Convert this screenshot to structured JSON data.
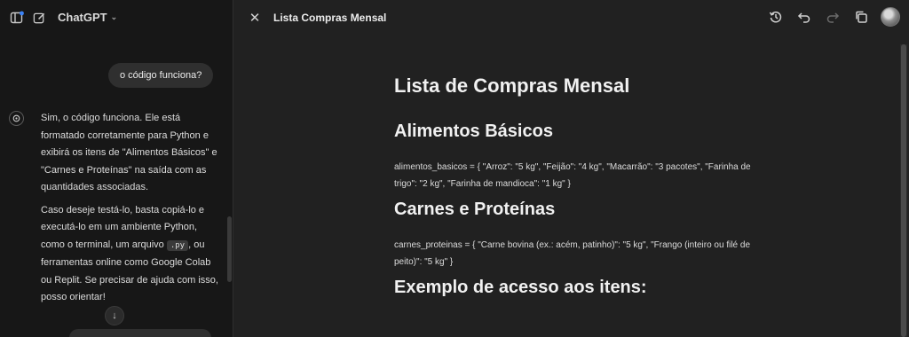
{
  "sidebar": {
    "model_label": "ChatGPT",
    "icons": [
      "sidebar-toggle-icon",
      "new-chat-icon",
      "chevron-down-icon"
    ]
  },
  "chat": {
    "user_message": "o código funciona?",
    "assistant_p1": "Sim, o código funciona. Ele está formatado corretamente para Python e exibirá os itens de \"Alimentos Básicos\" e \"Carnes e Proteínas\" na saída com as quantidades associadas.",
    "assistant_p2_a": "Caso deseje testá-lo, basta copiá-lo e executá-lo em um ambiente Python, como o terminal, um arquivo ",
    "assistant_p2_code": ".py",
    "assistant_p2_b": ", ou ferramentas online como Google Colab ou Replit. Se precisar de ajuda com isso, posso orientar!",
    "scroll_down_glyph": "↓"
  },
  "canvas": {
    "title": "Lista Compras Mensal",
    "close_glyph": "✕",
    "actions": [
      "history-icon",
      "undo-icon",
      "redo-icon",
      "copy-icon",
      "avatar"
    ],
    "doc": {
      "h1": "Lista de Compras Mensal",
      "h2_1": "Alimentos Básicos",
      "p_1": "alimentos_basicos = { \"Arroz\": \"5 kg\", \"Feijão\": \"4 kg\", \"Macarrão\": \"3 pacotes\", \"Farinha de trigo\": \"2 kg\", \"Farinha de mandioca\": \"1 kg\" }",
      "h2_2": "Carnes e Proteínas",
      "p_2": "carnes_proteinas = { \"Carne bovina (ex.: acém, patinho)\": \"5 kg\", \"Frango (inteiro ou filé de peito)\": \"5 kg\" }",
      "h2_3": "Exemplo de acesso aos itens:"
    }
  }
}
